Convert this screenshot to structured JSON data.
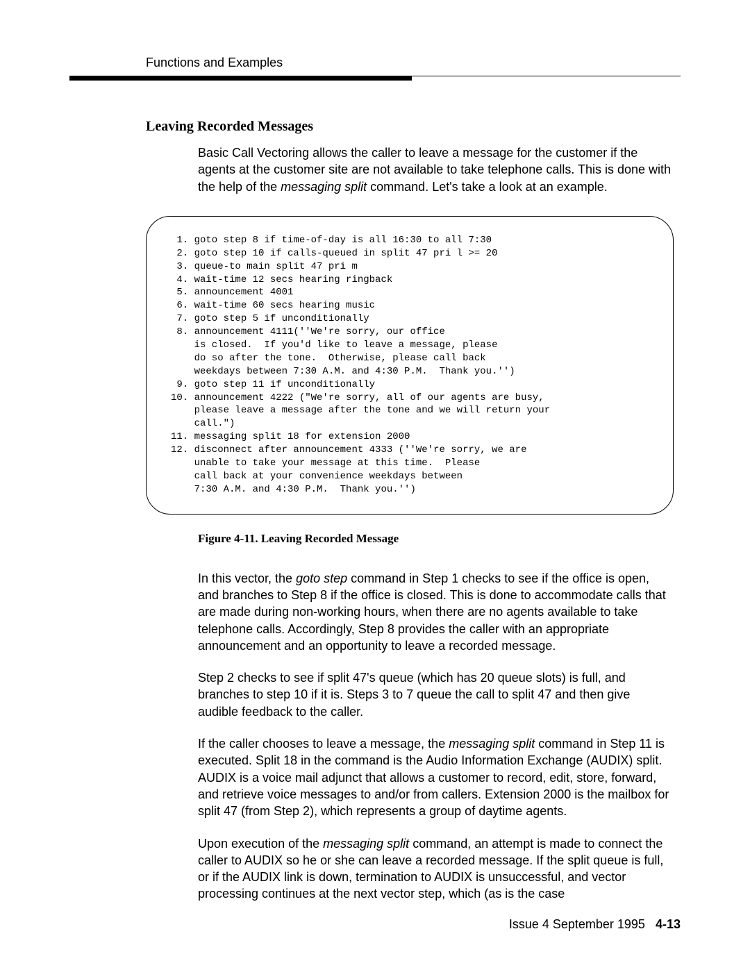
{
  "header": {
    "running_head": "Functions and Examples"
  },
  "section": {
    "title": "Leaving Recorded Messages",
    "intro_part1": "Basic Call Vectoring allows the caller to leave a message for the customer if the agents at the customer site are not available to take telephone calls.  This is done with the help of the ",
    "intro_cmd": "messaging split",
    "intro_part2": " command. Let's take a look at an example."
  },
  "code": {
    "lines": " 1. goto step 8 if time-of-day is all 16:30 to all 7:30\n 2. goto step 10 if calls-queued in split 47 pri l >= 20\n 3. queue-to main split 47 pri m\n 4. wait-time 12 secs hearing ringback\n 5. announcement 4001\n 6. wait-time 60 secs hearing music\n 7. goto step 5 if unconditionally\n 8. announcement 4111(''We're sorry, our office\n    is closed.  If you'd like to leave a message, please\n    do so after the tone.  Otherwise, please call back\n    weekdays between 7:30 A.M. and 4:30 P.M.  Thank you.'')\n 9. goto step 11 if unconditionally\n10. announcement 4222 (\"We're sorry, all of our agents are busy,\n    please leave a message after the tone and we will return your\n    call.\")\n11. messaging split 18 for extension 2000\n12. disconnect after announcement 4333 (''We're sorry, we are\n    unable to take your message at this time.  Please\n    call back at your convenience weekdays between\n    7:30 A.M. and 4:30 P.M.  Thank you.'')"
  },
  "figure": {
    "caption": "Figure 4-11.   Leaving Recorded Message"
  },
  "paras": {
    "p1a": "In this vector, the ",
    "p1cmd": "goto step",
    "p1b": " command in Step 1 checks to see if the office is open, and branches to Step 8 if the office is closed.  This is done to accommodate calls that are made during non-working hours, when there are no agents available to take telephone calls. Accordingly, Step 8 provides the caller with an appropriate announcement and an opportunity to leave a recorded message.",
    "p2": "Step 2 checks to see if split 47's queue (which has 20 queue slots) is full, and branches to step 10 if it is. Steps 3 to 7 queue the call to split 47 and then give audible feedback to the caller.",
    "p3a": "If the caller chooses to leave a message, the ",
    "p3cmd": "messaging split",
    "p3b": " command in Step 11 is executed. Split 18 in the command is the Audio Information Exchange (AUDIX) split.  AUDIX is a voice mail adjunct that allows a customer to record, edit, store, forward, and retrieve voice messages to and/or from callers. Extension 2000 is the mailbox for split 47 (from Step 2), which represents a group of daytime agents.",
    "p4a": "Upon execution of the ",
    "p4cmd": "messaging split",
    "p4b": " command, an attempt is made to connect the caller to AUDIX so he or she can leave a recorded message. If the split queue is full, or if the AUDIX link is down, termination to AUDIX is unsuccessful, and vector processing continues at the next vector step, which (as is the case"
  },
  "footer": {
    "issue": "Issue  4 September 1995",
    "page": "4-13"
  }
}
